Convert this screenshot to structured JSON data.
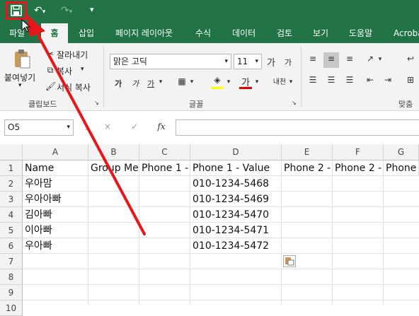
{
  "quick_access": {
    "save_icon": "save-icon",
    "undo_icon": "undo-icon",
    "redo_icon": "redo-icon",
    "customize_icon": "customize-icon"
  },
  "tabs": [
    "파일",
    "홈",
    "삽입",
    "페이지 레이아웃",
    "수식",
    "데이터",
    "검토",
    "보기",
    "도움말",
    "Acroba"
  ],
  "active_tab": "홈",
  "ribbon": {
    "clipboard": {
      "paste_label": "붙여넣기",
      "cut_label": "잘라내기",
      "copy_label": "복사",
      "format_painter_label": "서식 복사",
      "group_title": "클립보드"
    },
    "font": {
      "font_name": "맑은 고딕",
      "font_size": "11",
      "bold": "가",
      "italic": "가",
      "underline": "가",
      "group_title": "글꼴",
      "phonetic": "내천"
    },
    "alignment": {
      "group_title": "맞춤"
    }
  },
  "formula_bar": {
    "name_box": "O5",
    "fx": "fx",
    "cancel": "×",
    "enter": "✓",
    "value": ""
  },
  "colors": {
    "excel_green": "#217346",
    "highlight_red": "#e8151b"
  },
  "sheet": {
    "columns": [
      "A",
      "B",
      "C",
      "D",
      "E",
      "F",
      "G"
    ],
    "rows": [
      "1",
      "2",
      "3",
      "4",
      "5",
      "6",
      "7",
      "8",
      "9",
      "10"
    ],
    "headers": [
      "Name",
      "Group Me",
      "Phone 1 -",
      "Phone 1 - Value",
      "Phone 2 -",
      "Phone 2 -",
      "Phone"
    ],
    "data": [
      {
        "name": "우아맘",
        "phone": "010-1234-5468"
      },
      {
        "name": "우아아빠",
        "phone": "010-1234-5469"
      },
      {
        "name": "김아빠",
        "phone": "010-1234-5470"
      },
      {
        "name": "이아빠",
        "phone": "010-1234-5471"
      },
      {
        "name": "우아빠",
        "phone": "010-1234-5472"
      }
    ]
  }
}
